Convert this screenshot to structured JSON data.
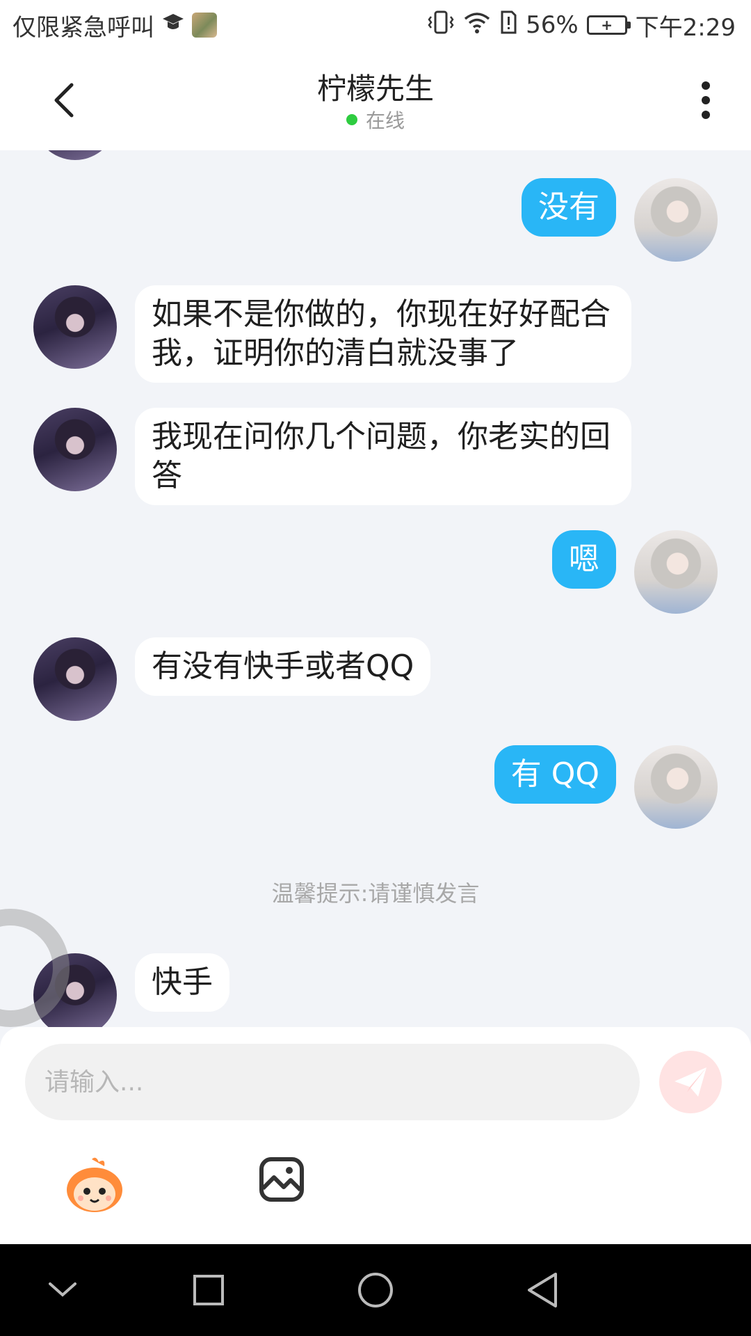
{
  "status_bar": {
    "left_text": "仅限紧急呼叫",
    "battery_percent": "56%",
    "time": "下午2:29",
    "icons": [
      "graduation-cap-icon",
      "game-app-icon",
      "vibrate-icon",
      "wifi-icon",
      "alert-icon",
      "battery-charging-icon"
    ]
  },
  "header": {
    "title": "柠檬先生",
    "status": "在线",
    "icons": [
      "back-icon",
      "more-vertical-icon"
    ]
  },
  "messages": [
    {
      "from": "self",
      "text": "没有"
    },
    {
      "from": "other",
      "text": "如果不是你做的，你现在好好配合我，证明你的清白就没事了"
    },
    {
      "from": "other",
      "text": "我现在问你几个问题，你老实的回答"
    },
    {
      "from": "self",
      "text": "嗯"
    },
    {
      "from": "other",
      "text": "有没有快手或者QQ"
    },
    {
      "from": "self",
      "text": "有 QQ"
    },
    {
      "from": "system",
      "text": "温馨提示:请谨慎发言"
    },
    {
      "from": "other",
      "text": "快手"
    }
  ],
  "input": {
    "placeholder": "请输入...",
    "value": ""
  },
  "toolbar": {
    "icons": [
      "emoji-mascot-icon",
      "image-icon",
      "send-icon"
    ]
  },
  "nav_bar": {
    "icons": [
      "collapse-icon",
      "recents-icon",
      "home-icon",
      "back-triangle-icon"
    ]
  },
  "colors": {
    "self_bubble": "#29b6f6",
    "other_bubble": "#ffffff",
    "background": "#f2f4f8",
    "online": "#2ecc40"
  }
}
